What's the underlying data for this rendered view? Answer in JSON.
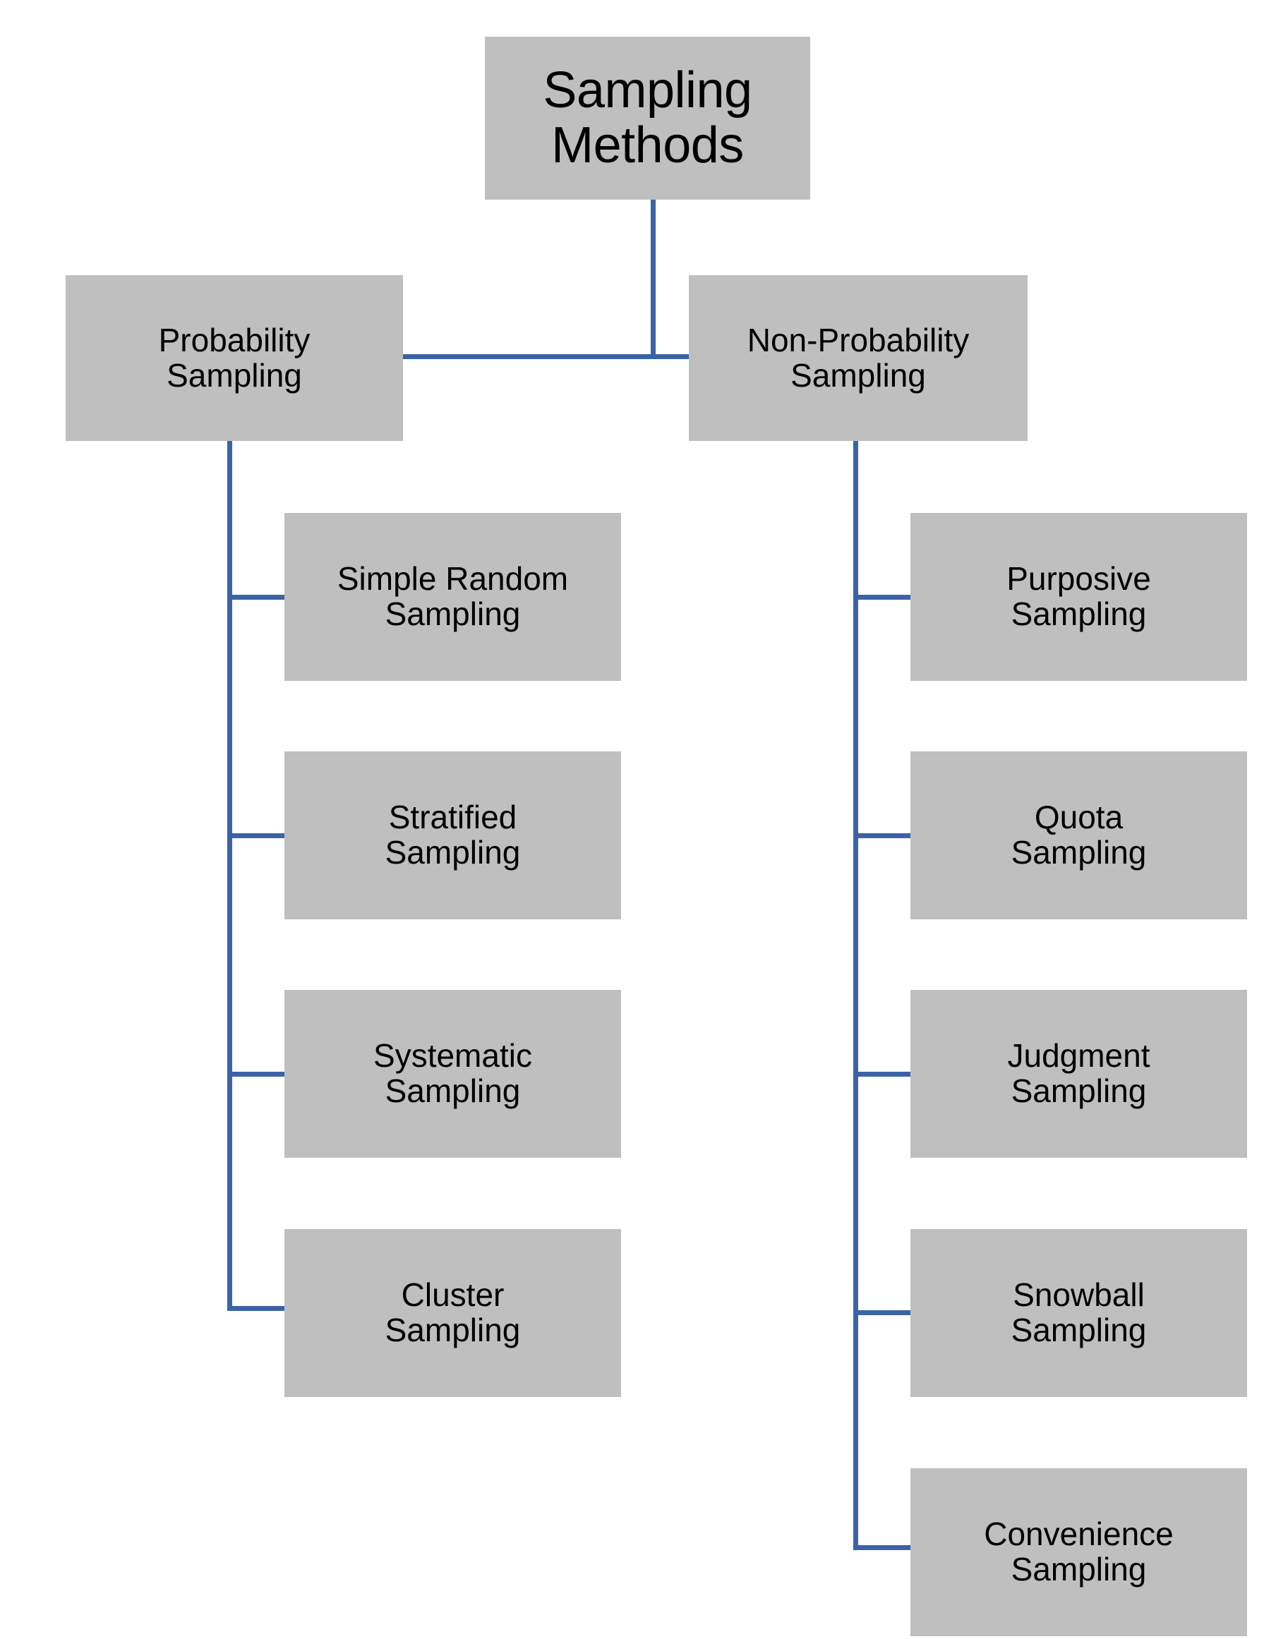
{
  "diagram": {
    "title": "Sampling Methods",
    "colors": {
      "node_fill": "#BFBFBF",
      "connector": "#3B63A6",
      "text": "#000000",
      "background": "#FFFFFF"
    },
    "root": {
      "label": "Sampling\nMethods"
    },
    "branches": [
      {
        "id": "probability",
        "label": "Probability\nSampling",
        "children": [
          {
            "id": "simple-random-sampling",
            "label": "Simple Random\nSampling"
          },
          {
            "id": "stratified-sampling",
            "label": "Stratified\nSampling"
          },
          {
            "id": "systematic-sampling",
            "label": "Systematic\nSampling"
          },
          {
            "id": "cluster-sampling",
            "label": "Cluster\nSampling"
          }
        ]
      },
      {
        "id": "non-probability",
        "label": "Non-Probability\nSampling",
        "children": [
          {
            "id": "purposive-sampling",
            "label": "Purposive\nSampling"
          },
          {
            "id": "quota-sampling",
            "label": "Quota\nSampling"
          },
          {
            "id": "judgment-sampling",
            "label": "Judgment\nSampling"
          },
          {
            "id": "snowball-sampling",
            "label": "Snowball\nSampling"
          },
          {
            "id": "convenience-sampling",
            "label": "Convenience\nSampling"
          }
        ]
      }
    ]
  }
}
